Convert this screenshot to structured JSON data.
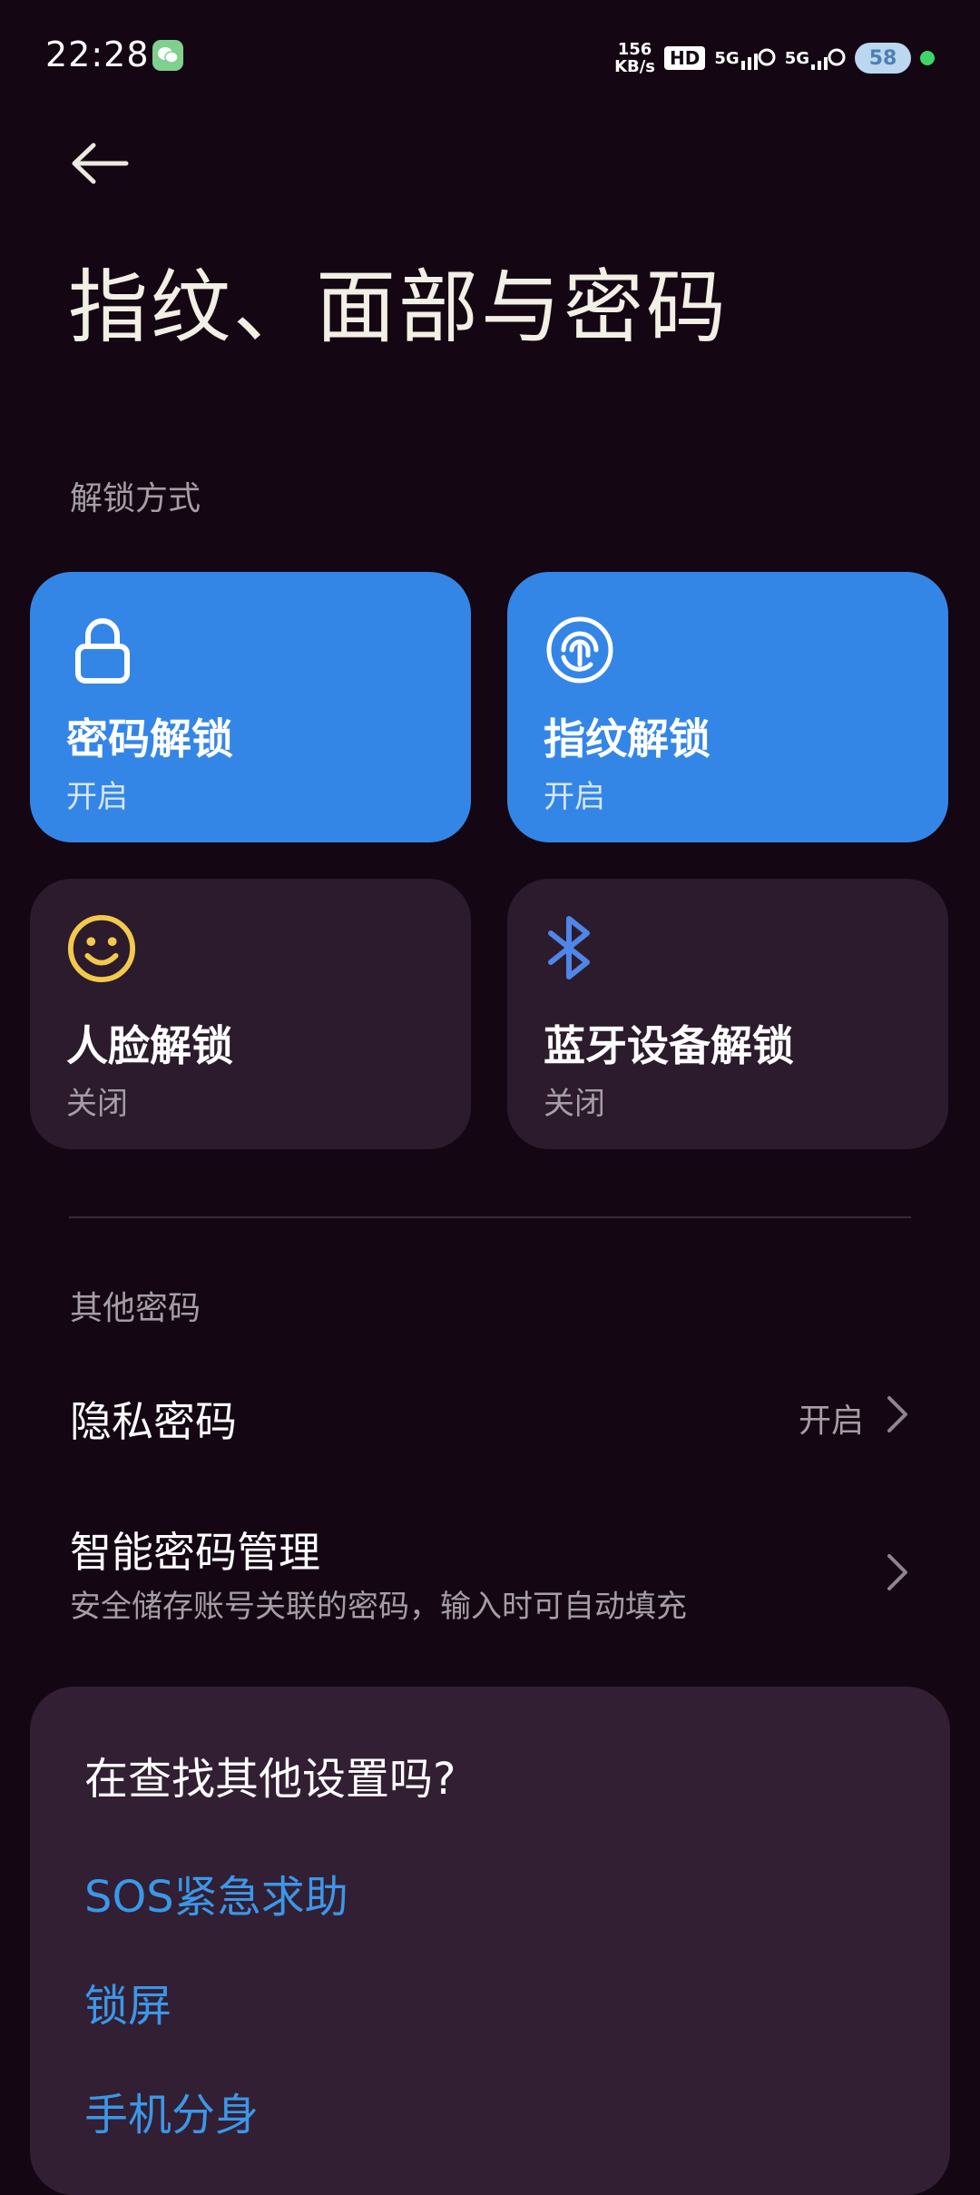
{
  "status_bar": {
    "time": "22:28",
    "net_speed_value": "156",
    "net_speed_unit": "KB/s",
    "hd_label": "HD",
    "signal1": "5G",
    "signal2": "5G",
    "weather_temp": "58"
  },
  "header": {
    "title": "指纹、面部与密码"
  },
  "unlock_section": {
    "label": "解锁方式",
    "cards": [
      {
        "title": "密码解锁",
        "status": "开启",
        "icon": "lock-icon"
      },
      {
        "title": "指纹解锁",
        "status": "开启",
        "icon": "fingerprint-icon"
      },
      {
        "title": "人脸解锁",
        "status": "关闭",
        "icon": "face-icon"
      },
      {
        "title": "蓝牙设备解锁",
        "status": "关闭",
        "icon": "bluetooth-icon"
      }
    ]
  },
  "other_section": {
    "label": "其他密码",
    "privacy": {
      "title": "隐私密码",
      "value": "开启"
    },
    "smart": {
      "title": "智能密码管理",
      "subtitle": "安全储存账号关联的密码，输入时可自动填充"
    }
  },
  "suggestions": {
    "title": "在查找其他设置吗?",
    "links": [
      "SOS紧急求助",
      "锁屏",
      "手机分身"
    ]
  },
  "colors": {
    "background": "#140713",
    "card_on": "#3486e6",
    "card_off": "#2c1b2d",
    "link": "#3b97e8",
    "face_icon": "#f2c94c",
    "bluetooth_icon": "#4f86e8"
  }
}
